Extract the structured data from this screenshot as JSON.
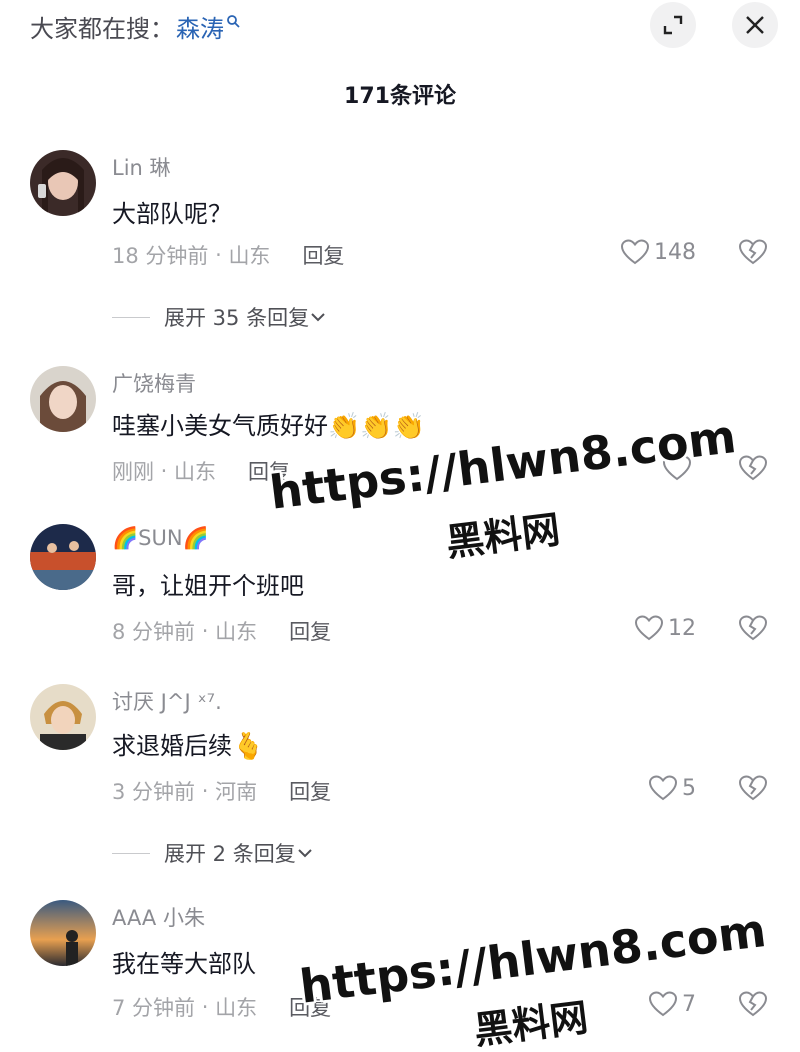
{
  "search": {
    "label": "大家都在搜：",
    "keyword": "森涛"
  },
  "header": {
    "comment_count": "171条评论"
  },
  "comments": [
    {
      "username": "Lin 琳",
      "text": "大部队呢？",
      "time": "18 分钟前",
      "location": "山东",
      "reply_label": "回复",
      "likes": "148",
      "expand_label": "展开 35 条回复"
    },
    {
      "username": "广饶梅青",
      "text": "哇塞小美女气质好好",
      "emoji": "👏👏👏",
      "time": "刚刚",
      "location": "山东",
      "reply_label": "回复",
      "likes": ""
    },
    {
      "username": "🌈SUN🌈",
      "text": "哥，让姐开个班吧",
      "time": "8 分钟前",
      "location": "山东",
      "reply_label": "回复",
      "likes": "12"
    },
    {
      "username": "讨厌 J^J ˣ⁷.",
      "text": "求退婚后续",
      "emoji": "🫰",
      "time": "3 分钟前",
      "location": "河南",
      "reply_label": "回复",
      "likes": "5",
      "expand_label": "展开 2 条回复"
    },
    {
      "username": "AAA 小朱",
      "text": "我在等大部队",
      "time": "7 分钟前",
      "location": "山东",
      "reply_label": "回复",
      "likes": "7"
    }
  ],
  "watermarks": [
    {
      "url": "https://hlwn8.com",
      "name": "黑料网"
    },
    {
      "url": "https://hlwn8.com",
      "name": "黑料网"
    }
  ]
}
